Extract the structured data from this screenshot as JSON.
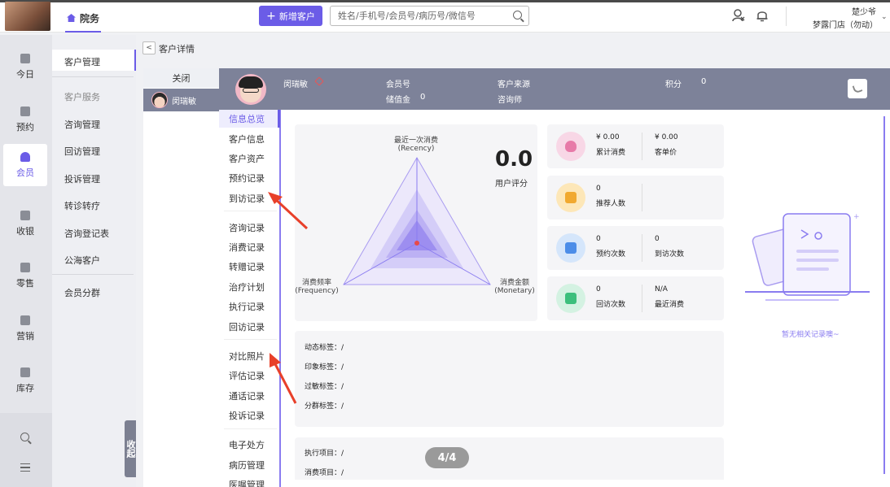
{
  "top": {
    "module": "院务",
    "add_button": "新增客户",
    "search_placeholder": "姓名/手机号/会员号/病历号/微信号",
    "user_name": "楚少爷",
    "store_name": "梦露门店（勿动）"
  },
  "sidenav": [
    {
      "label": "今日",
      "icon": "chart-icon"
    },
    {
      "label": "预约",
      "icon": "calendar-icon"
    },
    {
      "label": "会员",
      "icon": "member-icon",
      "active": true
    },
    {
      "label": "收银",
      "icon": "yuan-icon"
    },
    {
      "label": "零售",
      "icon": "bag-icon"
    },
    {
      "label": "营销",
      "icon": "bookmark-icon"
    },
    {
      "label": "库存",
      "icon": "box-icon"
    }
  ],
  "subnav": {
    "active": "客户管理",
    "group": "客户服务",
    "items": [
      "咨询管理",
      "回访管理",
      "投诉管理",
      "转诊转疗",
      "咨询登记表",
      "公海客户"
    ],
    "extra": "会员分群",
    "collapse": "收起"
  },
  "breadcrumb": {
    "back": "<",
    "title": "客户详情"
  },
  "tabs": {
    "close": "关闭",
    "customer": "闵瑞敏"
  },
  "header": {
    "name": "闵瑞敏",
    "member_no_label": "会员号",
    "stored_value_label": "储值金",
    "stored_value": "0",
    "source_label": "客户来源",
    "consultant_label": "咨询师",
    "points_label": "积分",
    "points": "0"
  },
  "records": [
    "信息总览",
    "客户信息",
    "客户资产",
    "预约记录",
    "到访记录",
    "咨询记录",
    "消费记录",
    "转赠记录",
    "治疗计划",
    "执行记录",
    "回访记录",
    "对比照片",
    "评估记录",
    "通话记录",
    "投诉记录",
    "电子处方",
    "病历管理",
    "医嘱管理"
  ],
  "radar": {
    "top": "最近一次消费",
    "top_en": "(Recency)",
    "left": "消费频率",
    "left_en": "(Frequency)",
    "right": "消费金额",
    "right_en": "(Monetary)",
    "score": "0.0",
    "score_label": "用户评分"
  },
  "stats": [
    {
      "icon": "money-bag-icon",
      "color": "#f8d7e6",
      "glyph": "#e77aa8",
      "v1": "¥ 0.00",
      "l1": "累计消费",
      "v2": "¥ 0.00",
      "l2": "客单价"
    },
    {
      "icon": "thumbs-up-icon",
      "color": "#fde7b8",
      "glyph": "#f1a92f",
      "v1": "0",
      "l1": "推荐人数",
      "v2": "",
      "l2": ""
    },
    {
      "icon": "calendar-check-icon",
      "color": "#d5e6fb",
      "glyph": "#4c8de8",
      "v1": "0",
      "l1": "预约次数",
      "v2": "0",
      "l2": "到访次数"
    },
    {
      "icon": "message-user-icon",
      "color": "#d4f2e2",
      "glyph": "#3cbf7c",
      "v1": "0",
      "l1": "回访次数",
      "v2": "N/A",
      "l2": "最近消费"
    }
  ],
  "tags": [
    {
      "label": "动态标签：",
      "value": "/"
    },
    {
      "label": "印象标签：",
      "value": "/"
    },
    {
      "label": "过敏标签：",
      "value": "/"
    },
    {
      "label": "分群标签：",
      "value": "/"
    }
  ],
  "items": [
    {
      "label": "执行项目：",
      "value": "/"
    },
    {
      "label": "消费项目：",
      "value": "/"
    }
  ],
  "pager": "4/4",
  "empty": "暂无相关记录噢~"
}
